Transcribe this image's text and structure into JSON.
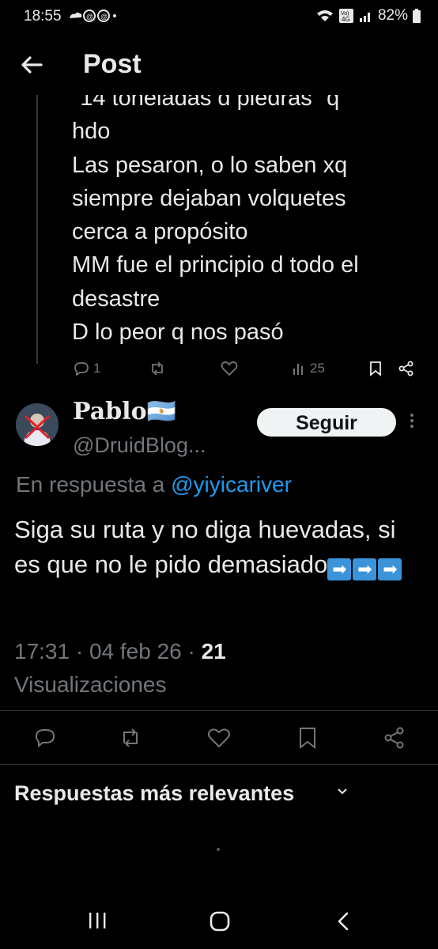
{
  "status_bar": {
    "time": "18:55",
    "battery": "82%",
    "network": "Vo) 4G"
  },
  "header": {
    "title": "Post"
  },
  "previous_post": {
    "text": "\"14 toneladas d piedras\" q\nhdo\nLas pesaron, o lo saben xq\nsiempre dejaban volquetes\ncerca a propósito\nMM fue el principio d todo el\ndesastre\nD lo peor q nos pasó",
    "replies": "1",
    "views": "25"
  },
  "post": {
    "author_name": "Pablo🇦🇷",
    "handle": "@DruidBlog...",
    "follow_label": "Seguir",
    "reply_prefix": "En respuesta a ",
    "reply_mention": "@yiyicariver",
    "text": "Siga su ruta y no diga huevadas, si es que no le pido demasiado",
    "timestamp": "17:31 · 04 feb 26 · ",
    "views_count": "21",
    "views_label": "Visualizaciones"
  },
  "replies_section": {
    "label": "Respuestas más relevantes"
  },
  "colors": {
    "background": "#000000",
    "text": "#e7e9ea",
    "muted": "#71767b",
    "link": "#1d9bf0"
  }
}
